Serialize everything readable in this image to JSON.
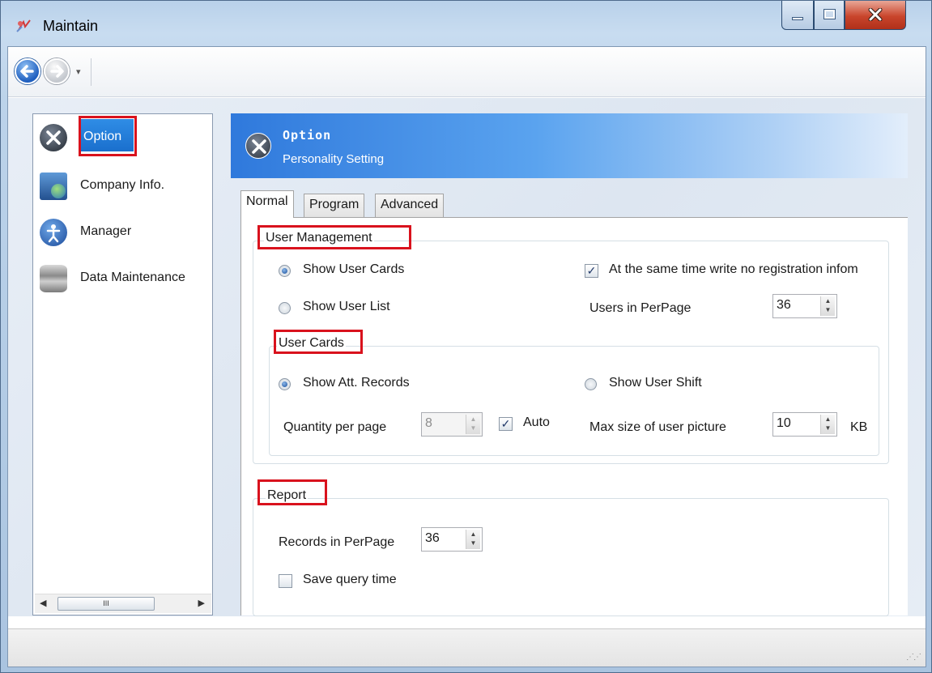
{
  "window": {
    "title": "Maintain"
  },
  "nav": {
    "dropdown_glyph": "▾"
  },
  "sidebar": {
    "items": [
      {
        "label": "Option",
        "icon": "wrench-tools-icon"
      },
      {
        "label": "Company Info.",
        "icon": "computer-globe-icon"
      },
      {
        "label": "Manager",
        "icon": "person-icon"
      },
      {
        "label": "Data Maintenance",
        "icon": "database-icon"
      }
    ],
    "scroll_thumb_glyph": "III"
  },
  "banner": {
    "title": "Option",
    "subtitle": "Personality Setting"
  },
  "tabs": [
    "Normal",
    "Program",
    "Advanced"
  ],
  "user_management": {
    "title": "User Management",
    "show_user_cards": "Show User Cards",
    "show_user_list": "Show User List",
    "write_no_reg": "At the same time write no registration infom",
    "users_per_page_label": "Users in PerPage",
    "users_per_page_value": "36",
    "selected_view": "Show User Cards",
    "write_no_reg_checked": true
  },
  "user_cards": {
    "title": "User Cards",
    "show_att_records": "Show Att. Records",
    "show_user_shift": "Show User Shift",
    "quantity_label": "Quantity per page",
    "quantity_value": "8",
    "auto_label": "Auto",
    "auto_checked": true,
    "max_size_label": "Max size of user picture",
    "max_size_value": "10",
    "max_size_unit": "KB",
    "selected_option": "Show Att. Records"
  },
  "report": {
    "title": "Report",
    "records_label": "Records in PerPage",
    "records_value": "36",
    "save_query_label": "Save query time",
    "save_query_checked": false
  },
  "colors": {
    "highlight_box": "#d9121d",
    "banner_start": "#2f79dc",
    "selected_item": "#1e7ee0"
  }
}
